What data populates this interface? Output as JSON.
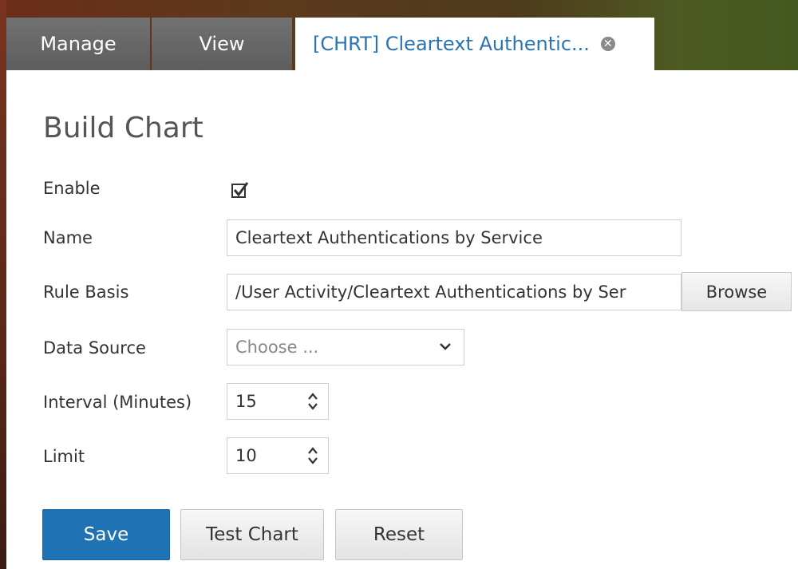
{
  "tabs": {
    "manage": "Manage",
    "view": "View",
    "active": "[CHRT] Cleartext Authentic..."
  },
  "page_title": "Build Chart",
  "form": {
    "enable": {
      "label": "Enable",
      "checked": true
    },
    "name": {
      "label": "Name",
      "value": "Cleartext Authentications by Service"
    },
    "rule_basis": {
      "label": "Rule Basis",
      "value": "/User Activity/Cleartext Authentications by Ser",
      "browse_label": "Browse"
    },
    "data_source": {
      "label": "Data Source",
      "placeholder": "Choose ..."
    },
    "interval": {
      "label": "Interval (Minutes)",
      "value": "15"
    },
    "limit": {
      "label": "Limit",
      "value": "10"
    }
  },
  "buttons": {
    "save": "Save",
    "test_chart": "Test Chart",
    "reset": "Reset"
  },
  "colors": {
    "primary": "#1f73b5",
    "active_tab_text": "#2a74b1"
  }
}
